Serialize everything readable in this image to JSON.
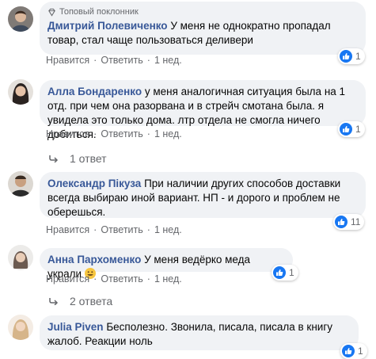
{
  "comments": [
    {
      "badge": "Топовый поклонник",
      "author": "Дмитрий Полевиченко",
      "text": "У меня не однократно пропадал товар, стал чаще пользоваться деливери",
      "like": "Нравится",
      "reply": "Ответить",
      "time": "1 нед.",
      "reactions": "1"
    },
    {
      "author": "Алла Бондаренко",
      "text": "у меня аналогичная ситуация была на 1 отд. при чем она разорвана и в стрейч смотана была. я увидела это только дома. лтр отдела не смогла ничего добиться.",
      "like": "Нравится",
      "reply": "Ответить",
      "time": "1 нед.",
      "reactions": "1",
      "replies": "1 ответ"
    },
    {
      "author": "Олександр Пікуза",
      "text": "При наличии других способов доставки всегда выбираю иной вариант. НП - и дорого и проблем не оберешься.",
      "like": "Нравится",
      "reply": "Ответить",
      "time": "1 нед.",
      "reactions": "11"
    },
    {
      "author": "Анна Пархоменко",
      "text": "У меня ведёрко меда украли",
      "like": "Нравится",
      "reply": "Ответить",
      "time": "1 нед.",
      "reactions": "1",
      "replies": "2 ответа"
    },
    {
      "author": "Julia Piven",
      "text": "Бесполезно. Звонила, писала, писала в книгу жалоб. Реакции ноль",
      "reactions": "1"
    }
  ],
  "colors": {
    "author": "#385898",
    "bubble": "#f0f2f5",
    "like": "#1877f2",
    "meta": "#65676b"
  },
  "icons": {
    "badge": "diamond-icon",
    "reaction": "thumbs-up-icon",
    "replies": "reply-arrow-icon"
  }
}
